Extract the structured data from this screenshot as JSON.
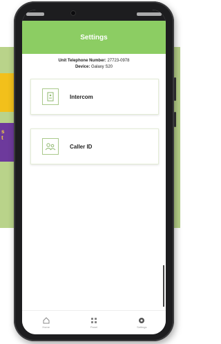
{
  "app": {
    "title": "Settings"
  },
  "unit_info": {
    "phone_label": "Unit Telephone Number:",
    "phone_value": "27723-0978",
    "device_label": "Device:",
    "device_value": "Galaxy S20"
  },
  "menu": [
    {
      "label": "Intercom",
      "icon": "intercom-icon"
    },
    {
      "label": "Caller ID",
      "icon": "caller-id-icon"
    }
  ],
  "bottom_nav": [
    {
      "label": "Home",
      "icon": "home-icon"
    },
    {
      "label": "Panel",
      "icon": "grid-icon"
    },
    {
      "label": "Settings",
      "icon": "settings-icon"
    }
  ],
  "backdrop": {
    "purple_tab_text": "s\nt"
  },
  "colors": {
    "brand_green": "#8ccd63",
    "backdrop_green": "#b9d38a",
    "accent_yellow": "#f2c01b",
    "accent_purple": "#6d3a9c"
  }
}
